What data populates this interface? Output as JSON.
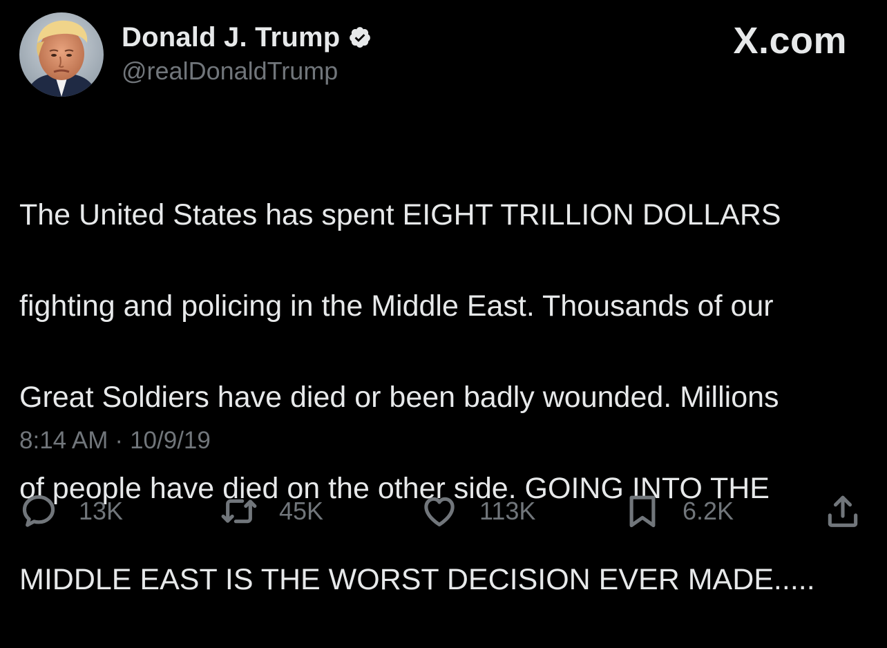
{
  "brand": "X.com",
  "author": {
    "display_name": "Donald J. Trump",
    "handle": "@realDonaldTrump",
    "verified_icon": "verified-badge-icon",
    "verified_color": "#1d9bf0"
  },
  "tweet": {
    "lines": [
      "The United States has spent EIGHT TRILLION DOLLARS",
      "fighting and policing in the Middle East. Thousands of our",
      "Great Soldiers have died or been badly wounded. Millions",
      "of people have died on the other side. GOING INTO THE",
      "MIDDLE EAST IS THE WORST DECISION EVER MADE....."
    ],
    "time": "8:14 AM",
    "separator": "·",
    "date": "10/9/19"
  },
  "actions": {
    "reply": {
      "icon": "reply-icon",
      "count": "13K"
    },
    "repost": {
      "icon": "repost-icon",
      "count": "45K"
    },
    "like": {
      "icon": "heart-icon",
      "count": "113K"
    },
    "bookmark": {
      "icon": "bookmark-icon",
      "count": "6.2K"
    },
    "share": {
      "icon": "share-icon"
    }
  },
  "colors": {
    "background": "#000000",
    "text": "#e7e9ea",
    "secondary": "#71767b"
  }
}
